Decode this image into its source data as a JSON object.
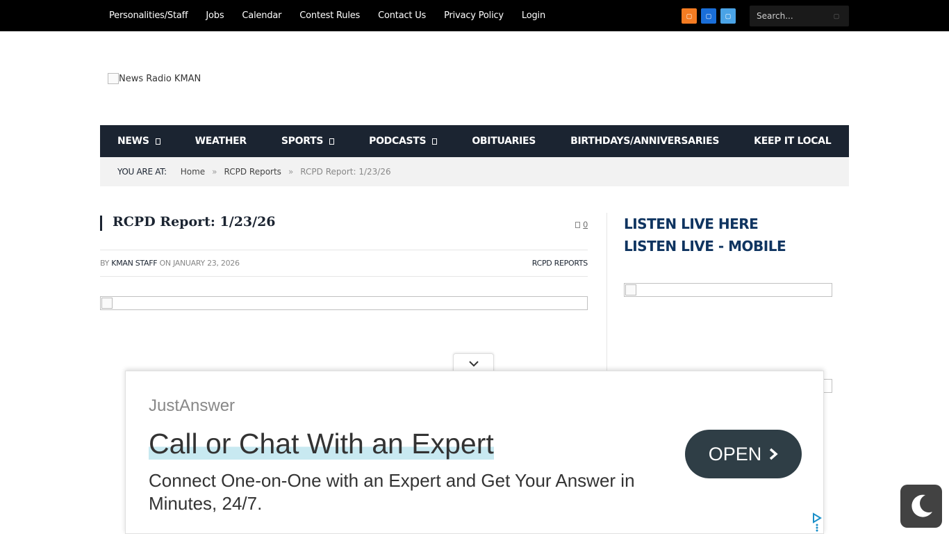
{
  "topbar": {
    "links": [
      "Personalities/Staff",
      "Jobs",
      "Calendar",
      "Contest Rules",
      "Contact Us",
      "Privacy Policy",
      "Login"
    ],
    "social": [
      {
        "name": "rss-icon",
        "color": "#f57c22"
      },
      {
        "name": "facebook-icon",
        "color": "#1a6ed8"
      },
      {
        "name": "twitter-icon",
        "color": "#4aa3e6"
      }
    ],
    "search_placeholder": "Search..."
  },
  "logo": {
    "alt": "News Radio KMAN"
  },
  "mainnav": {
    "items": [
      {
        "label": "NEWS",
        "dropdown": true
      },
      {
        "label": "WEATHER",
        "dropdown": false
      },
      {
        "label": "SPORTS",
        "dropdown": true
      },
      {
        "label": "PODCASTS",
        "dropdown": true
      },
      {
        "label": "OBITUARIES",
        "dropdown": false
      },
      {
        "label": "BIRTHDAYS/ANNIVERSARIES",
        "dropdown": false
      },
      {
        "label": "KEEP IT LOCAL",
        "dropdown": false
      }
    ]
  },
  "breadcrumb": {
    "label": "YOU ARE AT:",
    "home": "Home",
    "section": "RCPD Reports",
    "current": "RCPD Report: 1/23/26",
    "separator": "»"
  },
  "article": {
    "title": "RCPD Report: 1/23/26",
    "comments_count": "0",
    "by": "BY",
    "author": "KMAN STAFF",
    "on": "ON",
    "date": "JANUARY 23, 2026",
    "category": "RCPD REPORTS"
  },
  "sidebar": {
    "listen_live": "LISTEN LIVE HERE",
    "listen_mobile": "LISTEN LIVE - MOBILE"
  },
  "ad": {
    "brand": "JustAnswer",
    "headline": "Call or Chat With an Expert",
    "description": "Connect One-on-One with an Expert and Get Your Answer in Minutes, 24/7.",
    "button": "OPEN"
  },
  "colors": {
    "topbar": "#000000",
    "nav": "#1b2431",
    "accent": "#0f3460",
    "ad_button": "#2f3e46"
  }
}
